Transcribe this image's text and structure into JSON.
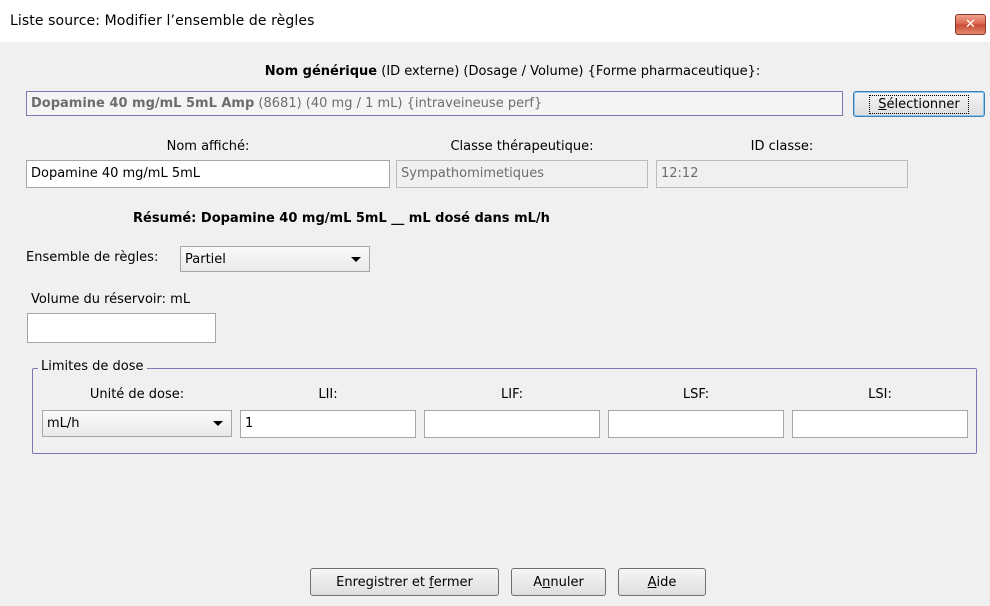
{
  "window": {
    "title": "Liste source:  Modifier l’ensemble de règles",
    "close_icon": "close-icon"
  },
  "generic": {
    "header_bold": "Nom générique",
    "header_rest": " (ID externe) (Dosage / Volume) {Forme pharmaceutique}:",
    "value_bold": "Dopamine 40 mg/mL 5mL Amp",
    "value_rest": " (8681) (40 mg / 1 mL) {intraveineuse perf}",
    "select_label_pre": "",
    "select_label_mnemonic": "S",
    "select_label_post": "électionner"
  },
  "fields": {
    "display_name_label": "Nom affiché:",
    "display_name_value": "Dopamine 40 mg/mL  5mL",
    "therapeutic_class_label": "Classe thérapeutique:",
    "therapeutic_class_value": "Sympathomimetiques",
    "class_id_label": "ID classe:",
    "class_id_value": "12:12"
  },
  "summary": {
    "text": "Résumé: Dopamine 40 mg/mL  5mL __ mL dosé dans mL/h"
  },
  "ruleset": {
    "label": "Ensemble de règles:",
    "value": "Partiel"
  },
  "reservoir": {
    "label": "Volume du réservoir: mL",
    "value": ""
  },
  "dose_limits": {
    "legend": "Limites de dose",
    "unit_label": "Unité de dose:",
    "unit_value": "mL/h",
    "lii_label": "LII:",
    "lii_value": "1",
    "lif_label": "LIF:",
    "lif_value": "",
    "lsf_label": "LSF:",
    "lsf_value": "",
    "lsi_label": "LSI:",
    "lsi_value": ""
  },
  "buttons": {
    "save_pre": "Enregistrer et ",
    "save_mnemonic": "f",
    "save_post": "ermer",
    "cancel_pre": "A",
    "cancel_mnemonic": "n",
    "cancel_post": "nuler",
    "help_pre": "",
    "help_mnemonic": "A",
    "help_post": "ide"
  }
}
